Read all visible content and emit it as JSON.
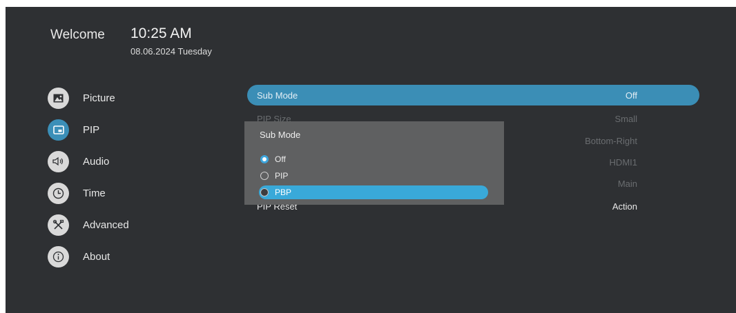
{
  "header": {
    "welcome": "Welcome",
    "time": "10:25 AM",
    "date": "08.06.2024 Tuesday"
  },
  "nav": {
    "items": [
      {
        "label": "Picture",
        "icon": "picture-icon"
      },
      {
        "label": "PIP",
        "icon": "pip-icon",
        "active": true
      },
      {
        "label": "Audio",
        "icon": "speaker-icon"
      },
      {
        "label": "Time",
        "icon": "clock-icon"
      },
      {
        "label": "Advanced",
        "icon": "tools-icon"
      },
      {
        "label": "About",
        "icon": "info-icon"
      }
    ]
  },
  "settings": {
    "rows": [
      {
        "label": "Sub Mode",
        "value": "Off"
      },
      {
        "label": "PIP Size",
        "value": "Small"
      },
      {
        "label": "",
        "value": "Bottom-Right"
      },
      {
        "label": "",
        "value": "HDMI1"
      },
      {
        "label": "",
        "value": "Main"
      },
      {
        "label": "PIP Reset",
        "value": "Action"
      }
    ]
  },
  "popup": {
    "title": "Sub Mode",
    "options": [
      "Off",
      "PIP",
      "PBP"
    ],
    "selected": "Off",
    "focused": "PBP"
  },
  "colors": {
    "background": "#2e3033",
    "accent": "#3b8eb6",
    "popup_bg": "#5f6061",
    "highlight": "#39a9d9"
  }
}
